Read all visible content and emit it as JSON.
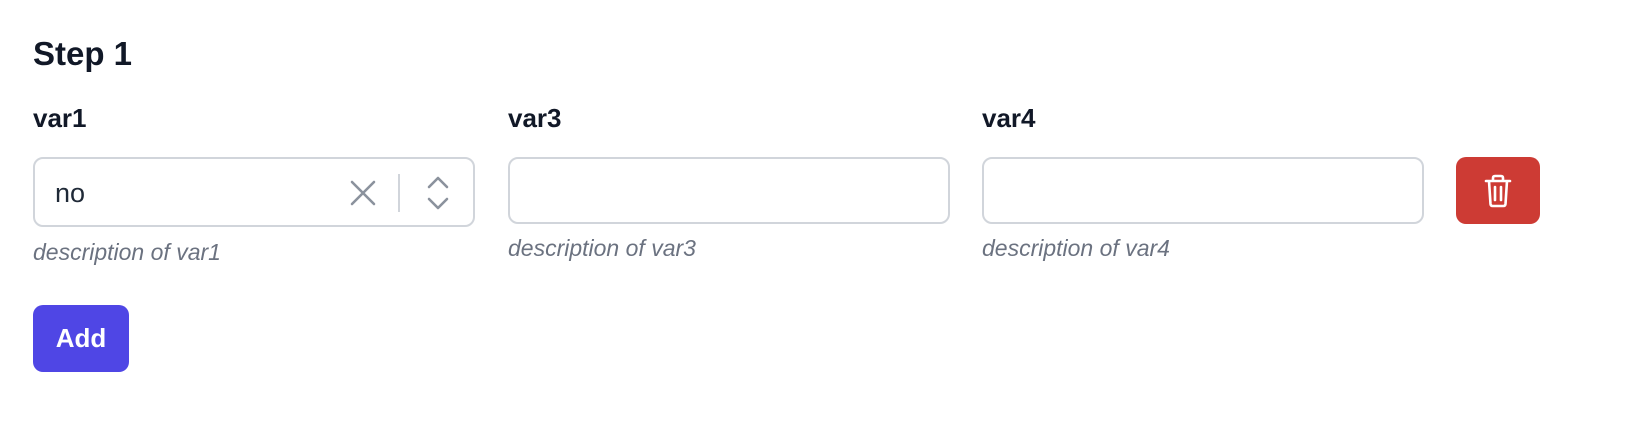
{
  "step": {
    "title": "Step 1"
  },
  "fields": [
    {
      "label": "var1",
      "type": "select",
      "value": "no",
      "description": "description of var1"
    },
    {
      "label": "var3",
      "type": "text",
      "value": "",
      "description": "description of var3"
    },
    {
      "label": "var4",
      "type": "text",
      "value": "",
      "description": "description of var4"
    }
  ],
  "actions": {
    "add_label": "Add",
    "delete_icon": "trash-icon",
    "clear_icon": "close-icon",
    "select_icon": "chevron-up-down-icon"
  },
  "colors": {
    "primary": "#4f46e5",
    "danger": "#cd3b34",
    "text": "#111827",
    "muted": "#6b7280",
    "border": "#d1d5db"
  }
}
